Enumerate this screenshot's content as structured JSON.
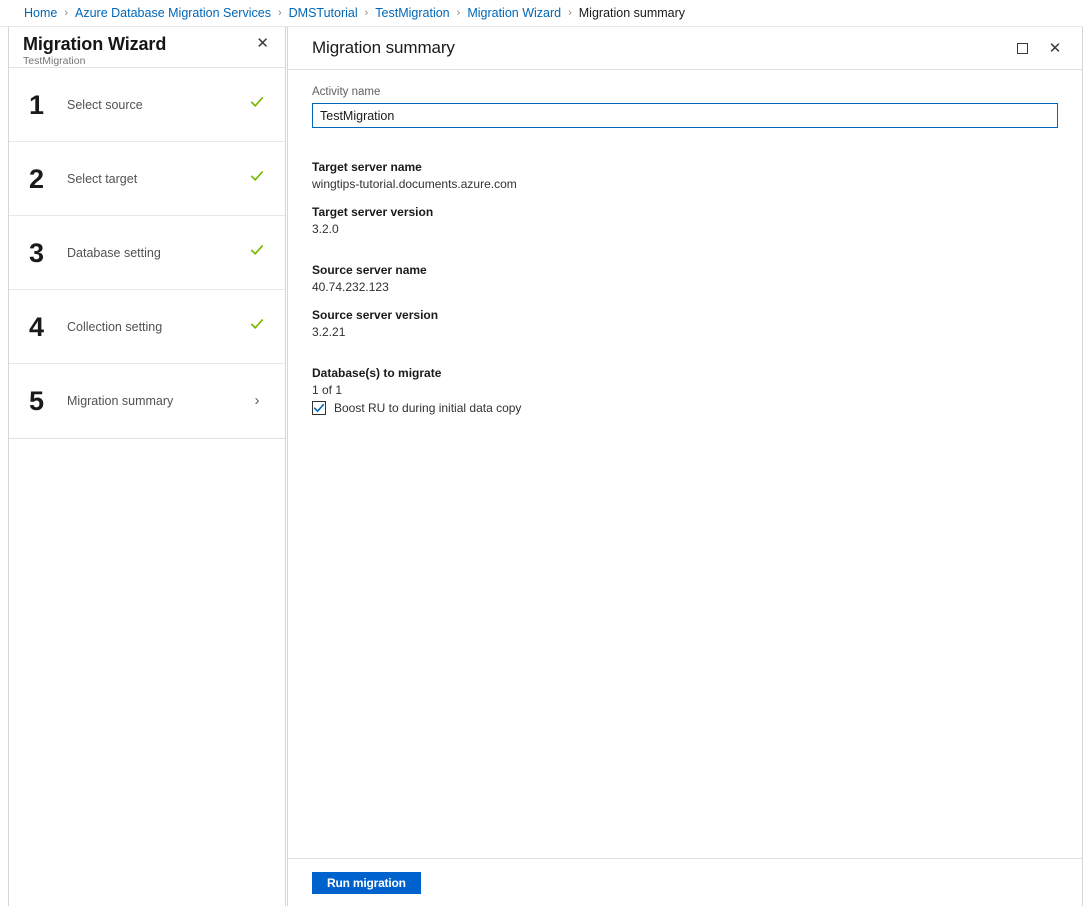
{
  "breadcrumb": {
    "separator": "›",
    "items": [
      {
        "label": "Home",
        "current": false
      },
      {
        "label": "Azure Database Migration Services",
        "current": false
      },
      {
        "label": "DMSTutorial",
        "current": false
      },
      {
        "label": "TestMigration",
        "current": false
      },
      {
        "label": "Migration Wizard",
        "current": false
      },
      {
        "label": "Migration summary",
        "current": true
      }
    ]
  },
  "wizard": {
    "title": "Migration Wizard",
    "subtitle": "TestMigration",
    "close_icon": "close-icon",
    "steps": [
      {
        "number": "1",
        "label": "Select source",
        "state": "complete",
        "icon": "check-icon"
      },
      {
        "number": "2",
        "label": "Select target",
        "state": "complete",
        "icon": "check-icon"
      },
      {
        "number": "3",
        "label": "Database setting",
        "state": "complete",
        "icon": "check-icon"
      },
      {
        "number": "4",
        "label": "Collection setting",
        "state": "complete",
        "icon": "check-icon"
      },
      {
        "number": "5",
        "label": "Migration summary",
        "state": "current",
        "icon": "chevron-right-icon",
        "chevron": "›"
      }
    ]
  },
  "content": {
    "title": "Migration summary",
    "maximize_icon": "maximize-icon",
    "close_icon": "close-icon",
    "activity": {
      "label": "Activity name",
      "value": "TestMigration",
      "placeholder": "Activity name"
    },
    "summary": [
      {
        "key": "Target server name",
        "value": "wingtips-tutorial.documents.azure.com",
        "spaced": false
      },
      {
        "key": "Target server version",
        "value": "3.2.0",
        "spaced": false
      },
      {
        "key": "Source server name",
        "value": "40.74.232.123",
        "spaced": true
      },
      {
        "key": "Source server version",
        "value": "3.2.21",
        "spaced": false
      }
    ],
    "databases": {
      "key": "Database(s) to migrate",
      "value": "1 of 1",
      "checkbox_label": "Boost RU to during initial data copy",
      "checkbox_checked": true
    },
    "footer": {
      "run_label": "Run migration"
    }
  },
  "colors": {
    "link": "#0067b8",
    "accent": "#0062cc",
    "check_green": "#7ab800",
    "input_focus_border": "#0067b8",
    "checkbox_check": "#0067b8"
  }
}
